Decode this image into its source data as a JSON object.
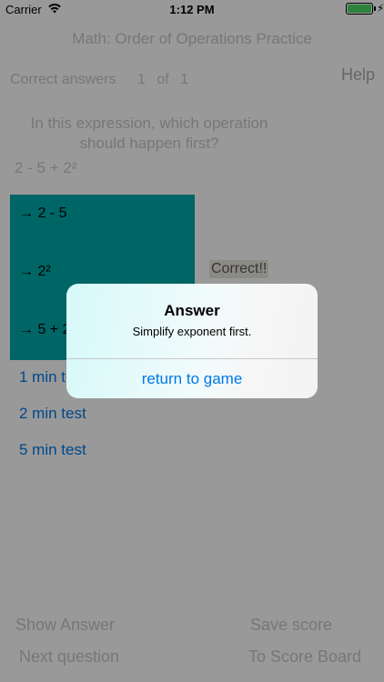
{
  "status_bar": {
    "carrier": "Carrier",
    "time": "1:12 PM",
    "wifi_icon": "wifi-icon",
    "battery_icon": "battery-icon",
    "charging_icon": "charging-bolt-icon",
    "battery_level_percent": 100
  },
  "app": {
    "title": "Math: Order of Operations Practice",
    "score_label": "Correct answers",
    "score_value": "1 of 1",
    "help_label": "Help",
    "question": "In this expression, which operation should happen first?",
    "expression": "2 - 5 + 2²",
    "choices": [
      "→ 2 - 5",
      "→ 2²",
      "→ 5 + 2"
    ],
    "feedback": "Correct!!",
    "tests": [
      "1 min test",
      "2 min test",
      "5 min test"
    ],
    "bottom_buttons": {
      "show_answer": "Show Answer",
      "save_score": "Save score",
      "next_question": "Next question",
      "score_board": "To Score Board"
    }
  },
  "alert": {
    "title": "Answer",
    "message": "Simplify exponent first.",
    "action": "return to game"
  },
  "colors": {
    "choices_background": "#00a9a8",
    "link_blue": "#0079e8",
    "dim_overlay": "rgba(0,0,0,0.40)"
  }
}
